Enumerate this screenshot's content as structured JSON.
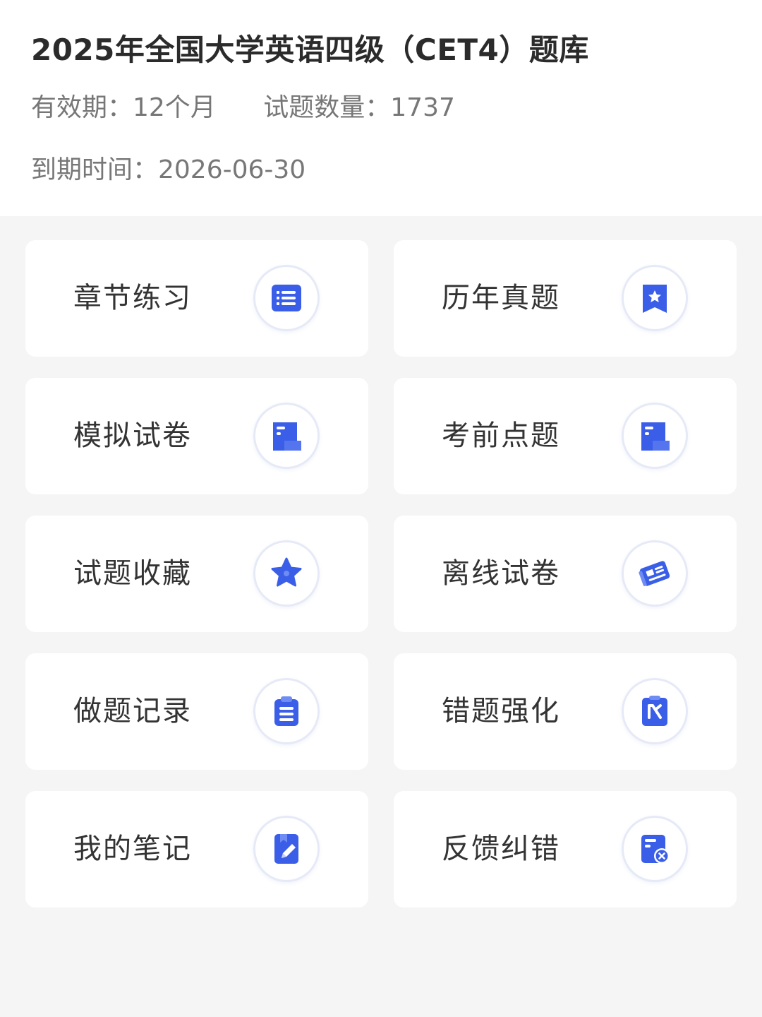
{
  "header": {
    "title": "2025年全国大学英语四级（CET4）题库",
    "validity": "有效期：12个月",
    "question_count": "试题数量：1737",
    "expiry": "到期时间：2026-06-30"
  },
  "colors": {
    "accent": "#3a5ee8",
    "accent_light": "#6f8cf3",
    "card_bg": "#ffffff",
    "page_bg": "#f5f5f6"
  },
  "menu": [
    {
      "label": "章节练习",
      "icon": "list-icon"
    },
    {
      "label": "历年真题",
      "icon": "star-bookmark-icon"
    },
    {
      "label": "模拟试卷",
      "icon": "paper-icon"
    },
    {
      "label": "考前点题",
      "icon": "paper-icon"
    },
    {
      "label": "试题收藏",
      "icon": "star-icon"
    },
    {
      "label": "离线试卷",
      "icon": "offline-paper-icon"
    },
    {
      "label": "做题记录",
      "icon": "clipboard-icon"
    },
    {
      "label": "错题强化",
      "icon": "wrong-question-icon"
    },
    {
      "label": "我的笔记",
      "icon": "note-pen-icon"
    },
    {
      "label": "反馈纠错",
      "icon": "feedback-icon"
    }
  ]
}
